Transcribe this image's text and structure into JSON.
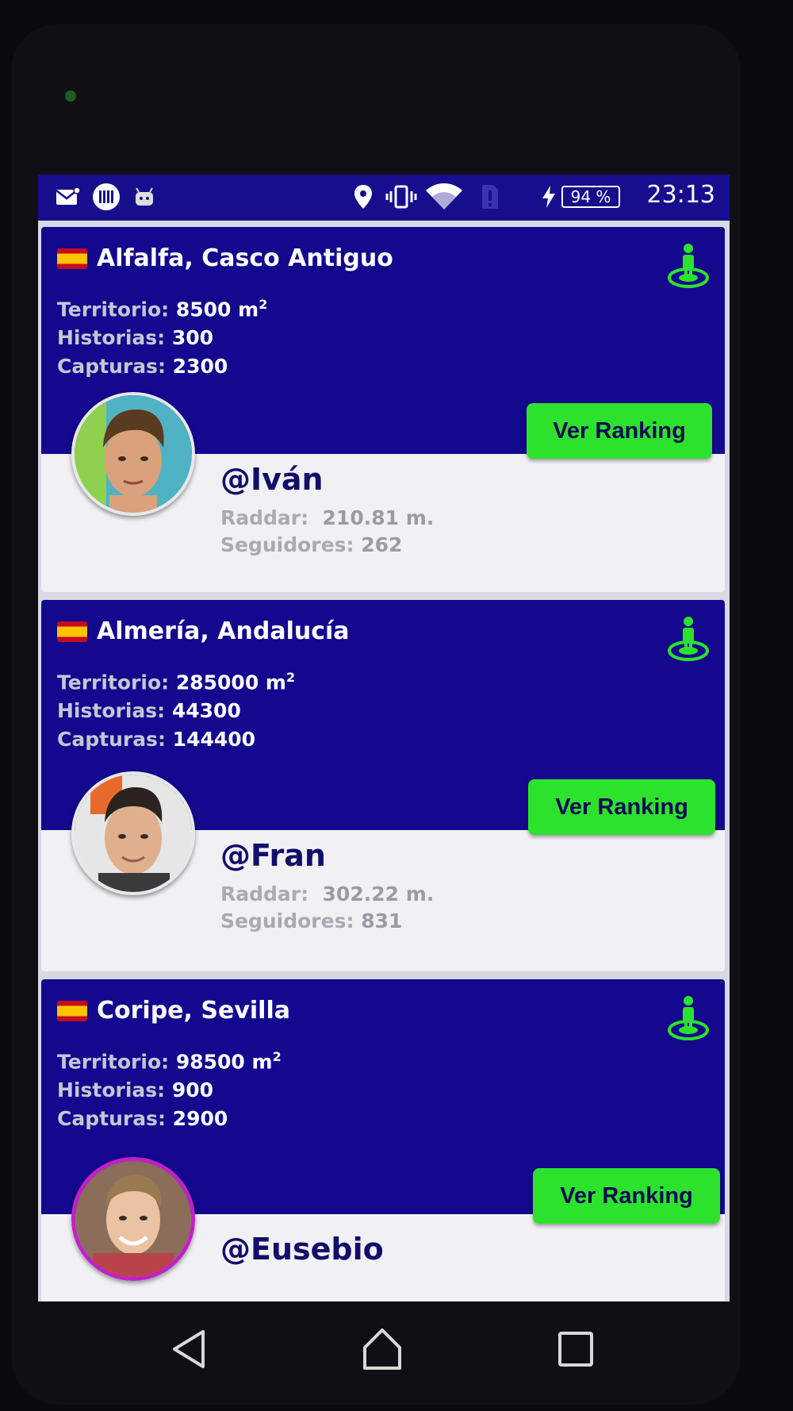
{
  "status_bar": {
    "time": "23:13",
    "battery": "94 %",
    "icons": [
      "mail-notification-icon",
      "app-notification-icon",
      "android-icon",
      "location-icon",
      "vibrate-icon",
      "wifi-icon",
      "sim-alert-icon",
      "charging-icon",
      "battery-icon"
    ]
  },
  "cards": [
    {
      "title": "Alfalfa, Casco Antiguo",
      "territorio_label": "Territorio:",
      "territorio_value": "8500 m",
      "territorio_unit_sup": "2",
      "historias_label": "Historias:",
      "historias_value": "300",
      "capturas_label": "Capturas:",
      "capturas_value": "2300",
      "button": "Ver Ranking",
      "username": "@Iván",
      "raddar_label": "Raddar:",
      "raddar_value": "210.81 m.",
      "seguidores_label": "Seguidores:",
      "seguidores_value": "262"
    },
    {
      "title": "Almería, Andalucía",
      "territorio_label": "Territorio:",
      "territorio_value": "285000 m",
      "territorio_unit_sup": "2",
      "historias_label": "Historias:",
      "historias_value": "44300",
      "capturas_label": "Capturas:",
      "capturas_value": "144400",
      "button": "Ver Ranking",
      "username": "@Fran",
      "raddar_label": "Raddar:",
      "raddar_value": "302.22 m.",
      "seguidores_label": "Seguidores:",
      "seguidores_value": "831"
    },
    {
      "title": "Coripe, Sevilla",
      "territorio_label": "Territorio:",
      "territorio_value": "98500 m",
      "territorio_unit_sup": "2",
      "historias_label": "Historias:",
      "historias_value": "900",
      "capturas_label": "Capturas:",
      "capturas_value": "2900",
      "button": "Ver Ranking",
      "username": "@Eusebio"
    }
  ],
  "colors": {
    "header_blue": "#13088e",
    "button_green": "#2de22d",
    "username_navy": "#130d6a",
    "premium_ring": "#c21fc9"
  }
}
